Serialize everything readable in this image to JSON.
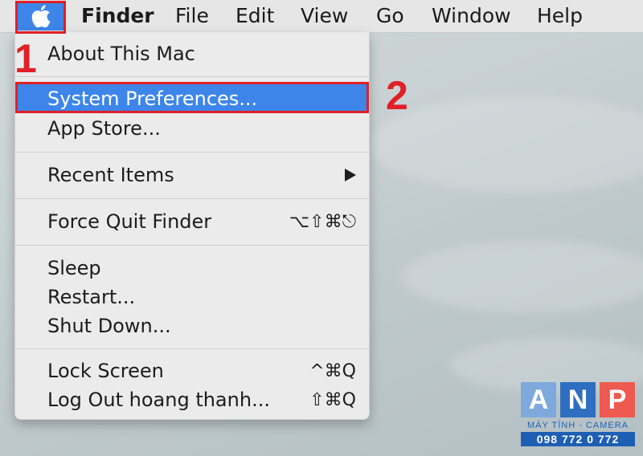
{
  "menubar": {
    "apple_icon": "apple-logo",
    "items": [
      "Finder",
      "File",
      "Edit",
      "View",
      "Go",
      "Window",
      "Help"
    ]
  },
  "apple_menu": {
    "items": [
      {
        "label": "About This Mac"
      },
      {
        "label": "System Preferences...",
        "highlighted": true
      },
      {
        "label": "App Store..."
      },
      {
        "label": "Recent Items",
        "submenu_icon": "triangle-right-icon"
      },
      {
        "label": "Force Quit Finder",
        "shortcut": "⌥⇧⌘⎋"
      },
      {
        "label": "Sleep"
      },
      {
        "label": "Restart..."
      },
      {
        "label": "Shut Down..."
      },
      {
        "label": "Lock Screen",
        "shortcut": "^⌘Q"
      },
      {
        "label": "Log Out hoang thanh...",
        "shortcut": "⇧⌘Q"
      }
    ]
  },
  "annotations": {
    "step1": "1",
    "step2": "2",
    "color": "#e01f26"
  },
  "watermark": {
    "letters": [
      "A",
      "N",
      "P"
    ],
    "tagline": "MÁY TÍNH - CAMERA",
    "phone": "098 772 0 772"
  },
  "colors": {
    "highlight": "#3d85e9",
    "menu_bg": "#ebebeb"
  }
}
